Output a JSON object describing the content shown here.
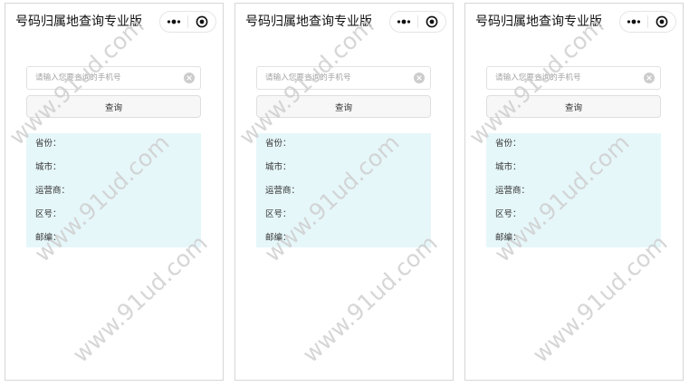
{
  "screens": [
    {
      "title": "号码归属地查询专业版",
      "capsule": {
        "more_icon": "more-icon",
        "close_icon": "close-icon"
      },
      "search": {
        "placeholder": "请输入您要查询的手机号",
        "value": "",
        "clear_icon": "clear-icon"
      },
      "query_button": {
        "label": "查询"
      },
      "result": {
        "fields": [
          {
            "label": "省份：",
            "value": ""
          },
          {
            "label": "城市：",
            "value": ""
          },
          {
            "label": "运营商：",
            "value": ""
          },
          {
            "label": "区号：",
            "value": ""
          },
          {
            "label": "邮编：",
            "value": ""
          }
        ]
      }
    },
    {
      "title": "号码归属地查询专业版",
      "capsule": {
        "more_icon": "more-icon",
        "close_icon": "close-icon"
      },
      "search": {
        "placeholder": "请输入您要查询的手机号",
        "value": "",
        "clear_icon": "clear-icon"
      },
      "query_button": {
        "label": "查询"
      },
      "result": {
        "fields": [
          {
            "label": "省份：",
            "value": ""
          },
          {
            "label": "城市：",
            "value": ""
          },
          {
            "label": "运营商：",
            "value": ""
          },
          {
            "label": "区号：",
            "value": ""
          },
          {
            "label": "邮编：",
            "value": ""
          }
        ]
      }
    },
    {
      "title": "号码归属地查询专业版",
      "capsule": {
        "more_icon": "more-icon",
        "close_icon": "close-icon"
      },
      "search": {
        "placeholder": "请输入您要查询的手机号",
        "value": "",
        "clear_icon": "clear-icon"
      },
      "query_button": {
        "label": "查询"
      },
      "result": {
        "fields": [
          {
            "label": "省份：",
            "value": ""
          },
          {
            "label": "城市：",
            "value": ""
          },
          {
            "label": "运营商：",
            "value": ""
          },
          {
            "label": "区号：",
            "value": ""
          },
          {
            "label": "邮编：",
            "value": ""
          }
        ]
      }
    }
  ],
  "watermark": {
    "text": "www.91ud.com"
  },
  "colors": {
    "frame_border": "#d6d6d6",
    "title": "#111111",
    "text": "#333333",
    "placeholder": "#a3a3a3",
    "input_border": "#e1e1e1",
    "button_bg": "#f7f7f7",
    "button_border": "#dedede",
    "result_bg": "#e6f7fa",
    "clear_icon": "#cccccc",
    "icon": "#111111",
    "watermark": "#cfcfcf"
  }
}
